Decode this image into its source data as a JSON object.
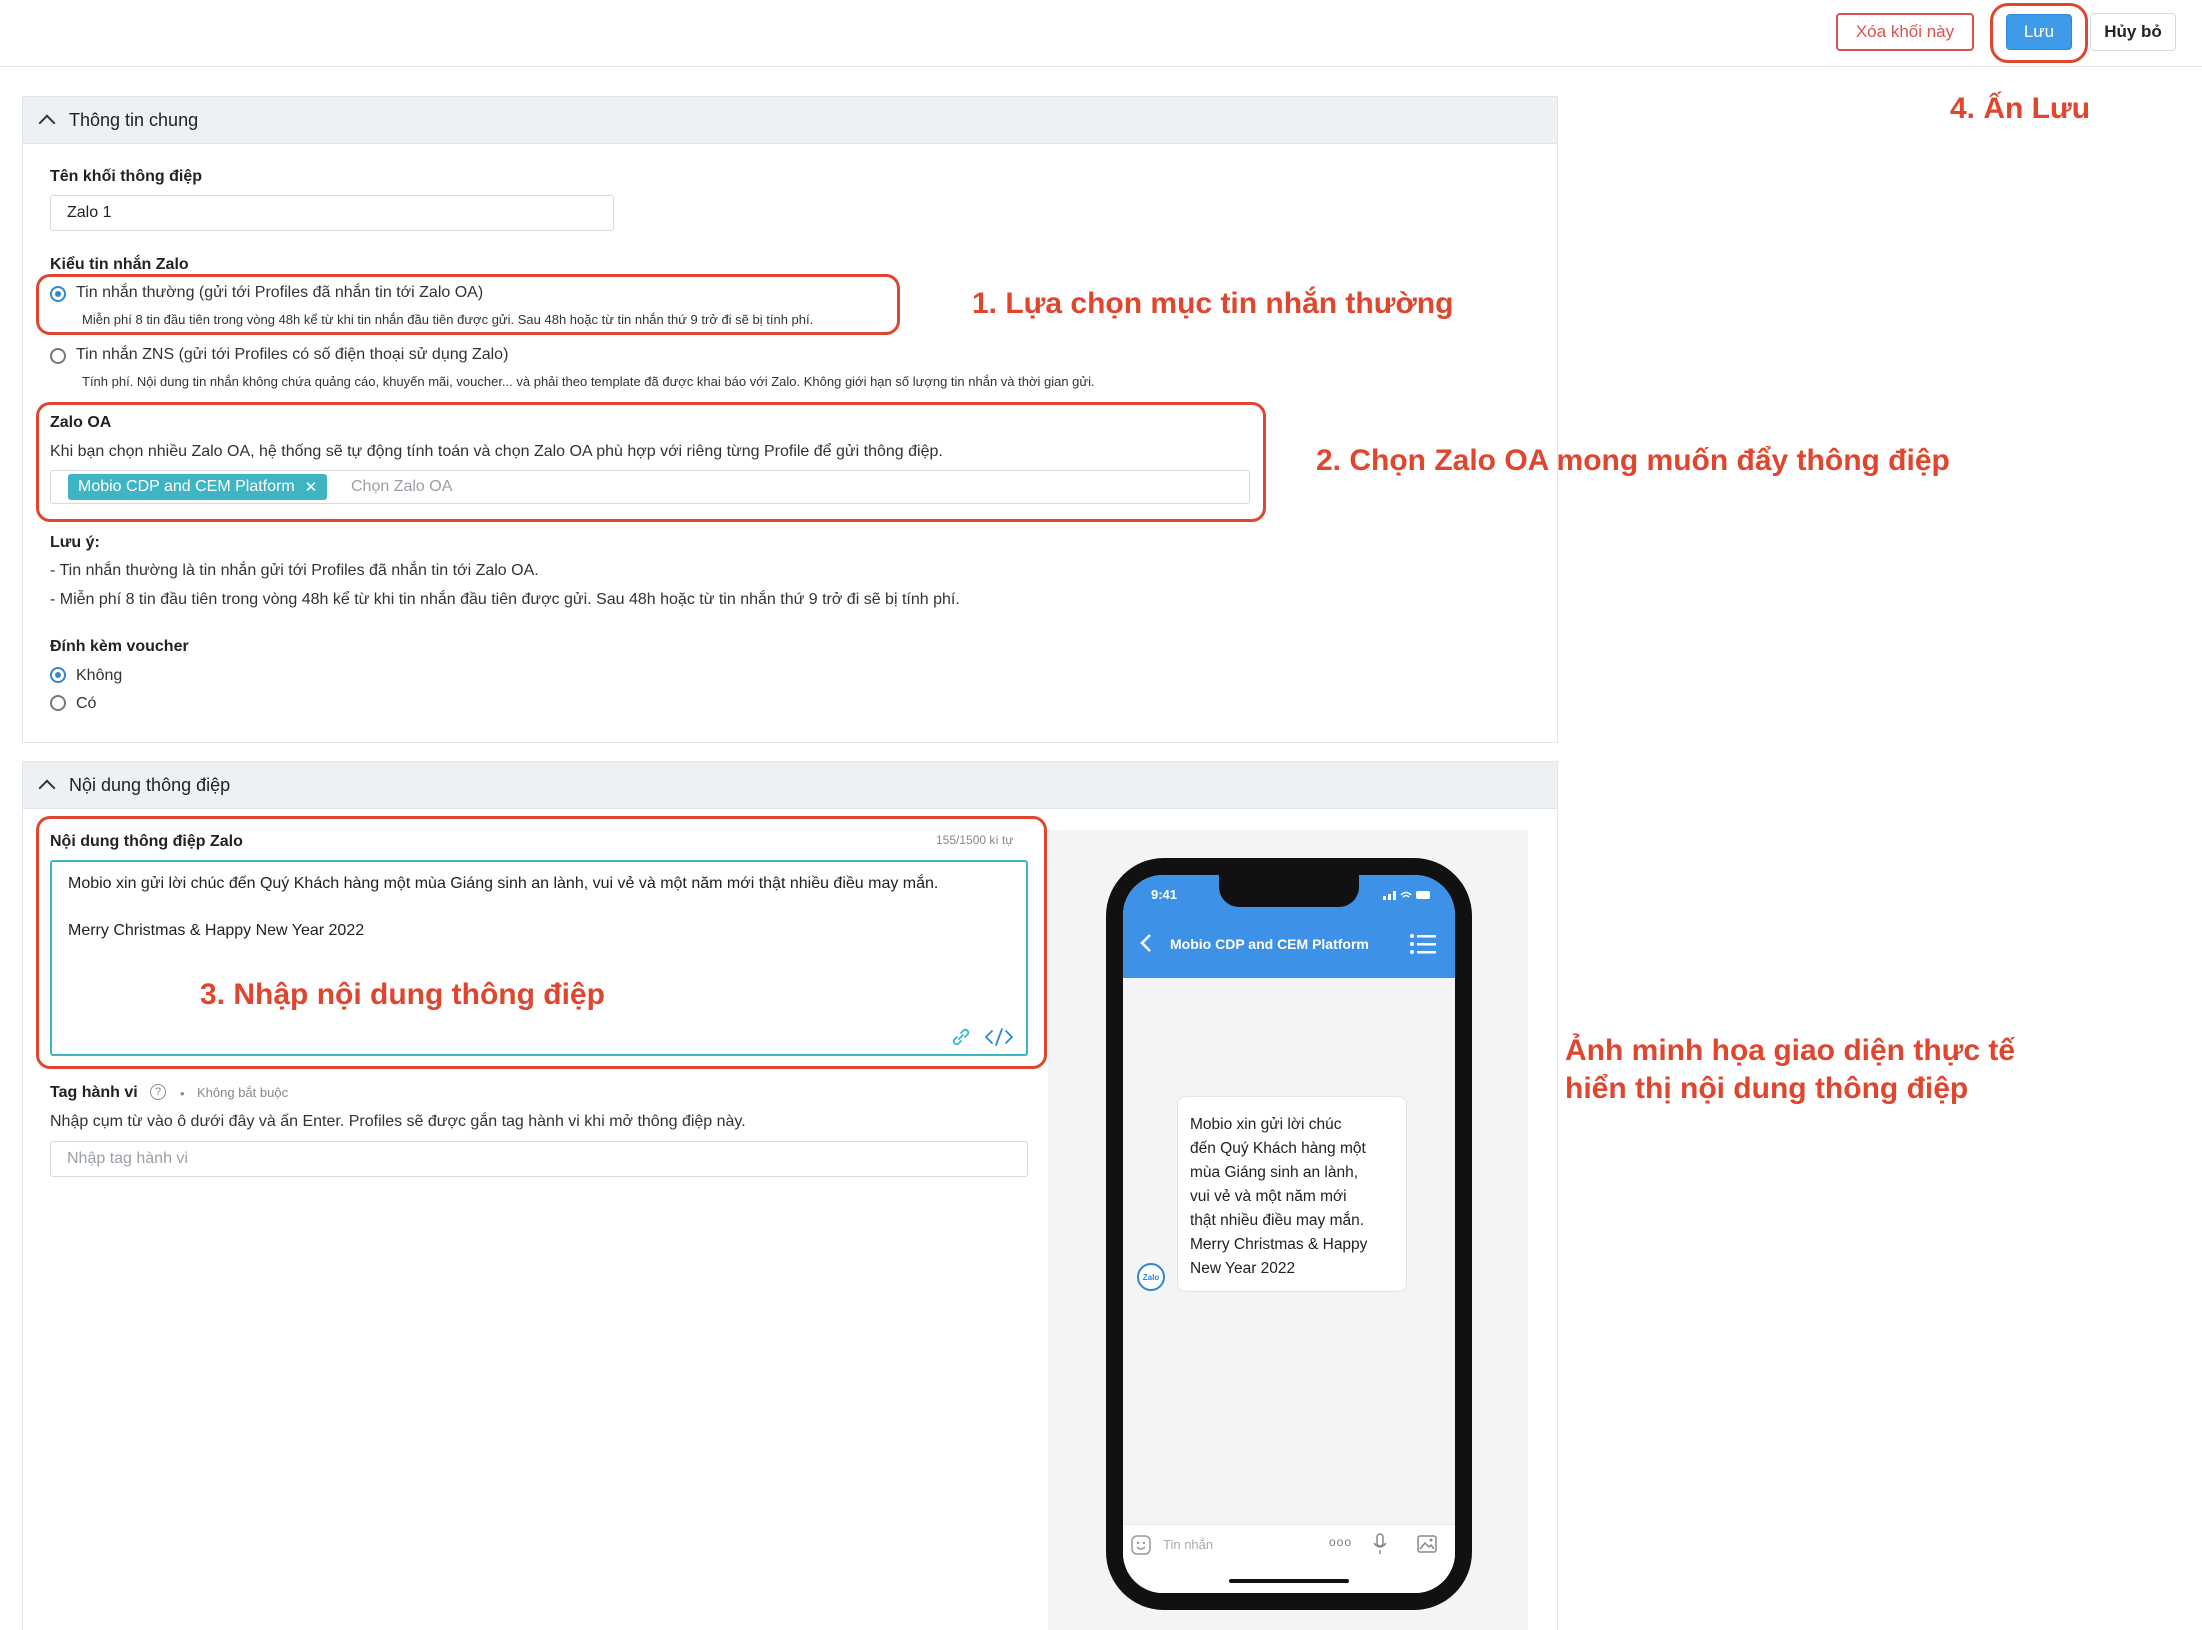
{
  "toolbar": {
    "delete_label": "Xóa khối này",
    "save_label": "Lưu",
    "cancel_label": "Hủy bỏ"
  },
  "general": {
    "title": "Thông tin chung",
    "name_label": "Tên khối thông điệp",
    "name_value": "Zalo 1",
    "type_label": "Kiểu tin nhắn Zalo",
    "options": [
      {
        "label": "Tin nhắn thường (gửi tới Profiles đã nhắn tin tới Zalo OA)",
        "desc": "Miễn phí 8 tin đầu tiên trong vòng 48h kể từ khi tin nhắn đầu tiên được gửi. Sau 48h hoặc từ tin nhắn thứ 9 trở đi sẽ bị tính phí.",
        "selected": true
      },
      {
        "label": "Tin nhắn ZNS (gửi tới Profiles có số điện thoại sử dụng Zalo)",
        "desc": "Tính phí. Nội dung tin nhắn không chứa quảng cáo, khuyến mãi, voucher... và phải theo template đã được khai báo với Zalo. Không giới hạn số lượng tin nhắn và thời gian gửi.",
        "selected": false
      }
    ],
    "oa_label": "Zalo OA",
    "oa_help": "Khi bạn chọn nhiều Zalo OA, hệ thống sẽ tự động tính toán và chọn Zalo OA phù hợp với riêng từng Profile để gửi thông điệp.",
    "oa_tag": "Mobio CDP and CEM Platform",
    "oa_placeholder": "Chọn Zalo OA",
    "note_label": "Lưu ý:",
    "note_lines": [
      "- Tin nhắn thường là tin nhắn gửi tới Profiles đã nhắn tin tới Zalo OA.",
      "- Miễn phí 8 tin đầu tiên trong vòng 48h kể từ khi tin nhắn đầu tiên được gửi. Sau 48h hoặc từ tin nhắn thứ 9 trở đi sẽ bị tính phí."
    ],
    "voucher_label": "Đính kèm voucher",
    "voucher_options": [
      {
        "label": "Không",
        "selected": true
      },
      {
        "label": "Có",
        "selected": false
      }
    ]
  },
  "content": {
    "title": "Nội dung thông điệp",
    "field_label": "Nội dung thông điệp Zalo",
    "counter": "155/1500 kí tự",
    "message_line1": "Mobio xin gửi lời chúc đến Quý Khách hàng một mùa Giáng sinh an lành, vui vẻ và một năm mới thật nhiều điều may mắn.",
    "message_line2": "Merry Christmas & Happy New Year 2022",
    "tag_label": "Tag hành vi",
    "tag_optional": "Không bắt buộc",
    "tag_help": "Nhập cụm từ vào ô dưới đây và ấn Enter. Profiles sẽ được gắn tag hành vi khi mở thông điệp này.",
    "tag_placeholder": "Nhập tag hành vi"
  },
  "phone": {
    "time": "9:41",
    "header_title": "Mobio CDP and CEM Platform",
    "bubble_lines": [
      "Mobio xin gửi lời chúc",
      "đến Quý Khách hàng một",
      "mùa Giáng sinh an lành,",
      "vui vẻ và một năm mới",
      "thật nhiều điều may mắn.",
      "Merry Christmas & Happy",
      "New Year 2022"
    ],
    "avatar_text": "Zalo",
    "input_placeholder": "Tin nhắn"
  },
  "annotations": {
    "step1": "1. Lựa chọn mục tin nhắn thường",
    "step2": "2. Chọn Zalo OA mong muốn đẩy thông điệp",
    "step3": "3. Nhập nội dung thông điệp",
    "step4": "4. Ấn Lưu",
    "preview_line1": "Ảnh minh họa giao diện thực tế",
    "preview_line2": "hiển thị nội dung thông điệp"
  },
  "colors": {
    "accent": "#3d9be9",
    "annotation": "#e0452e",
    "teal": "#3fb4c3",
    "danger": "#d9534f"
  },
  "icons": [
    "chevron-up-icon",
    "close-icon",
    "link-icon",
    "code-icon",
    "question-icon",
    "back-icon",
    "menu-icon",
    "emoji-icon",
    "more-icon",
    "mic-icon",
    "image-icon"
  ]
}
